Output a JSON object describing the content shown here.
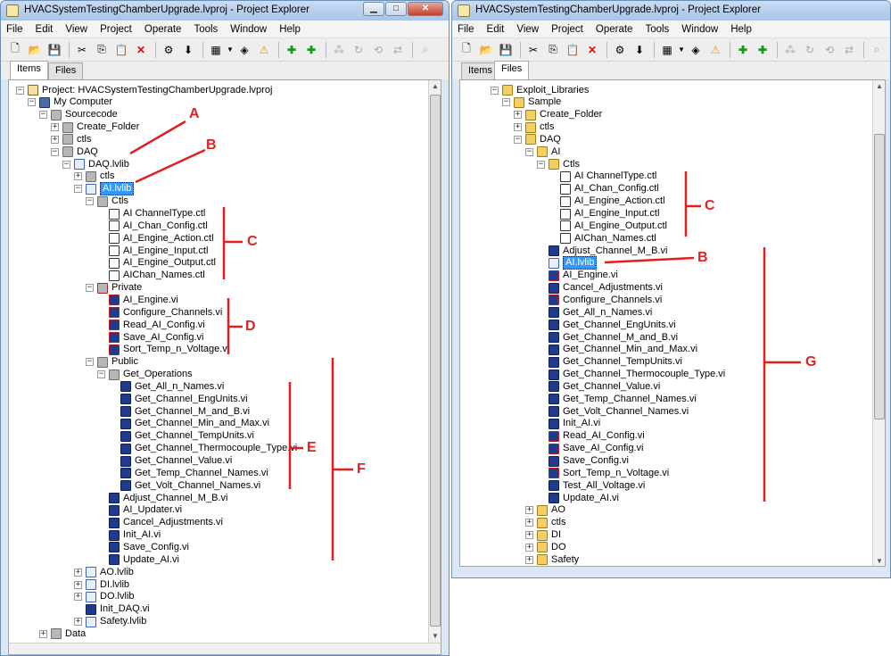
{
  "left": {
    "title": "HVACSystemTestingChamberUpgrade.lvproj - Project Explorer",
    "menu": [
      "File",
      "Edit",
      "View",
      "Project",
      "Operate",
      "Tools",
      "Window",
      "Help"
    ],
    "tabs": {
      "items": "Items",
      "files": "Files"
    },
    "tree": [
      {
        "label": "Project: HVACSystemTestingChamberUpgrade.lvproj",
        "icon": "project-icon"
      },
      {
        "label": "My Computer",
        "icon": "computer-icon"
      },
      {
        "label": "Sourcecode",
        "icon": "folder-icon"
      },
      {
        "label": "Create_Folder",
        "icon": "folder-icon"
      },
      {
        "label": "ctls",
        "icon": "folder-icon"
      },
      {
        "label": "DAQ",
        "icon": "folder-icon"
      },
      {
        "label": "DAQ.lvlib",
        "icon": "lvlib-icon"
      },
      {
        "label": "ctls",
        "icon": "folder-icon"
      },
      {
        "label": "AI.lvlib",
        "icon": "lvlib-icon"
      },
      {
        "label": "Ctls",
        "icon": "folder-icon"
      },
      {
        "label": "AI ChannelType.ctl",
        "icon": "ctl-icon"
      },
      {
        "label": "AI_Chan_Config.ctl",
        "icon": "ctl-icon"
      },
      {
        "label": "AI_Engine_Action.ctl",
        "icon": "ctl-icon"
      },
      {
        "label": "AI_Engine_Input.ctl",
        "icon": "ctl-icon"
      },
      {
        "label": "AI_Engine_Output.ctl",
        "icon": "ctl-icon"
      },
      {
        "label": "AIChan_Names.ctl",
        "icon": "ctl-icon"
      },
      {
        "label": "Private",
        "icon": "private-folder-icon"
      },
      {
        "label": "AI_Engine.vi",
        "icon": "private-vi-icon"
      },
      {
        "label": "Configure_Channels.vi",
        "icon": "private-vi-icon"
      },
      {
        "label": "Read_AI_Config.vi",
        "icon": "private-vi-icon"
      },
      {
        "label": "Save_AI_Config.vi",
        "icon": "private-vi-icon"
      },
      {
        "label": "Sort_Temp_n_Voltage.vi",
        "icon": "private-vi-icon"
      },
      {
        "label": "Public",
        "icon": "folder-icon"
      },
      {
        "label": "Get_Operations",
        "icon": "folder-icon"
      },
      {
        "label": "Get_All_n_Names.vi",
        "icon": "vi-icon"
      },
      {
        "label": "Get_Channel_EngUnits.vi",
        "icon": "vi-icon"
      },
      {
        "label": "Get_Channel_M_and_B.vi",
        "icon": "vi-icon"
      },
      {
        "label": "Get_Channel_Min_and_Max.vi",
        "icon": "vi-icon"
      },
      {
        "label": "Get_Channel_TempUnits.vi",
        "icon": "vi-icon"
      },
      {
        "label": "Get_Channel_Thermocouple_Type.vi",
        "icon": "vi-icon"
      },
      {
        "label": "Get_Channel_Value.vi",
        "icon": "vi-icon"
      },
      {
        "label": "Get_Temp_Channel_Names.vi",
        "icon": "vi-icon"
      },
      {
        "label": "Get_Volt_Channel_Names.vi",
        "icon": "vi-icon"
      },
      {
        "label": "Adjust_Channel_M_B.vi",
        "icon": "vi-icon"
      },
      {
        "label": "AI_Updater.vi",
        "icon": "vi-icon"
      },
      {
        "label": "Cancel_Adjustments.vi",
        "icon": "vi-icon"
      },
      {
        "label": "Init_AI.vi",
        "icon": "vi-icon"
      },
      {
        "label": "Save_Config.vi",
        "icon": "vi-icon"
      },
      {
        "label": "Update_AI.vi",
        "icon": "vi-icon"
      },
      {
        "label": "AO.lvlib",
        "icon": "lvlib-icon"
      },
      {
        "label": "DI.lvlib",
        "icon": "lvlib-icon"
      },
      {
        "label": "DO.lvlib",
        "icon": "lvlib-icon"
      },
      {
        "label": "Init_DAQ.vi",
        "icon": "vi-icon"
      },
      {
        "label": "Safety.lvlib",
        "icon": "lvlib-icon"
      },
      {
        "label": "Data",
        "icon": "folder-icon"
      }
    ],
    "annotations": [
      "A",
      "B",
      "C",
      "D",
      "E",
      "F"
    ]
  },
  "right": {
    "title": "HVACSystemTestingChamberUpgrade.lvproj - Project Explorer",
    "menu": [
      "File",
      "Edit",
      "View",
      "Project",
      "Operate",
      "Tools",
      "Window",
      "Help"
    ],
    "tabs": {
      "items": "Items",
      "files": "Files"
    },
    "tree": [
      {
        "label": "Exploit_Libraries",
        "icon": "folder-icon"
      },
      {
        "label": "Sample",
        "icon": "folder-icon"
      },
      {
        "label": "Create_Folder",
        "icon": "folder-icon"
      },
      {
        "label": "ctls",
        "icon": "folder-icon"
      },
      {
        "label": "DAQ",
        "icon": "folder-icon"
      },
      {
        "label": "AI",
        "icon": "folder-icon"
      },
      {
        "label": "Ctls",
        "icon": "folder-icon"
      },
      {
        "label": "AI ChannelType.ctl",
        "icon": "ctl-icon"
      },
      {
        "label": "AI_Chan_Config.ctl",
        "icon": "ctl-icon"
      },
      {
        "label": "AI_Engine_Action.ctl",
        "icon": "ctl-icon"
      },
      {
        "label": "AI_Engine_Input.ctl",
        "icon": "ctl-icon"
      },
      {
        "label": "AI_Engine_Output.ctl",
        "icon": "ctl-icon"
      },
      {
        "label": "AIChan_Names.ctl",
        "icon": "ctl-icon"
      },
      {
        "label": "Adjust_Channel_M_B.vi",
        "icon": "vi-icon"
      },
      {
        "label": "AI.lvlib",
        "icon": "lvlib-icon"
      },
      {
        "label": "AI_Engine.vi",
        "icon": "private-vi-icon"
      },
      {
        "label": "Cancel_Adjustments.vi",
        "icon": "vi-icon"
      },
      {
        "label": "Configure_Channels.vi",
        "icon": "private-vi-icon"
      },
      {
        "label": "Get_All_n_Names.vi",
        "icon": "vi-icon"
      },
      {
        "label": "Get_Channel_EngUnits.vi",
        "icon": "vi-icon"
      },
      {
        "label": "Get_Channel_M_and_B.vi",
        "icon": "vi-icon"
      },
      {
        "label": "Get_Channel_Min_and_Max.vi",
        "icon": "vi-icon"
      },
      {
        "label": "Get_Channel_TempUnits.vi",
        "icon": "vi-icon"
      },
      {
        "label": "Get_Channel_Thermocouple_Type.vi",
        "icon": "vi-icon"
      },
      {
        "label": "Get_Channel_Value.vi",
        "icon": "vi-icon"
      },
      {
        "label": "Get_Temp_Channel_Names.vi",
        "icon": "vi-icon"
      },
      {
        "label": "Get_Volt_Channel_Names.vi",
        "icon": "vi-icon"
      },
      {
        "label": "Init_AI.vi",
        "icon": "vi-icon"
      },
      {
        "label": "Read_AI_Config.vi",
        "icon": "private-vi-icon"
      },
      {
        "label": "Save_AI_Config.vi",
        "icon": "private-vi-icon"
      },
      {
        "label": "Save_Config.vi",
        "icon": "vi-icon"
      },
      {
        "label": "Sort_Temp_n_Voltage.vi",
        "icon": "private-vi-icon"
      },
      {
        "label": "Test_All_Voltage.vi",
        "icon": "vi-icon"
      },
      {
        "label": "Update_AI.vi",
        "icon": "vi-icon"
      },
      {
        "label": "AO",
        "icon": "folder-icon"
      },
      {
        "label": "ctls",
        "icon": "folder-icon"
      },
      {
        "label": "DI",
        "icon": "folder-icon"
      },
      {
        "label": "DO",
        "icon": "folder-icon"
      },
      {
        "label": "Safety",
        "icon": "folder-icon"
      }
    ],
    "annotations": [
      "C",
      "B",
      "G"
    ]
  }
}
